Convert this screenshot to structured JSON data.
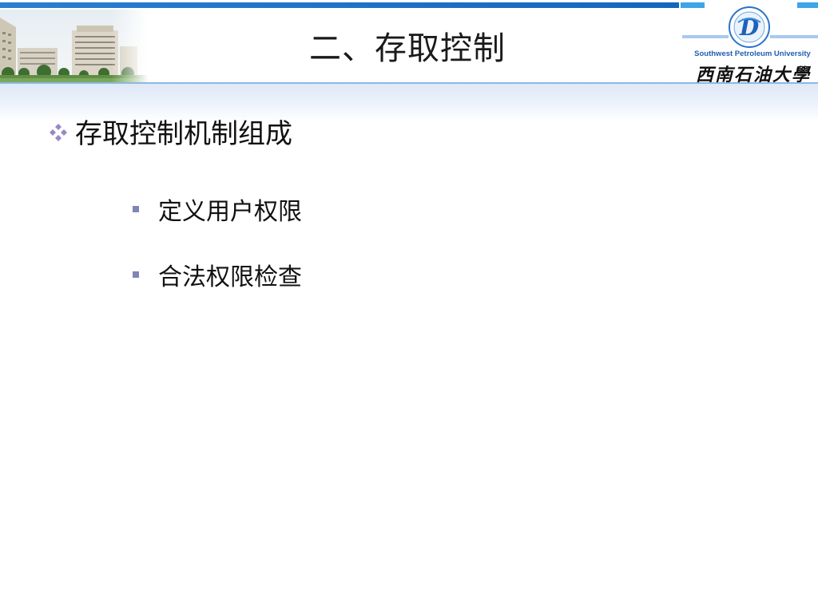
{
  "slide": {
    "title": "二、存取控制",
    "main_point": "存取控制机制组成",
    "sub_points": [
      "定义用户权限",
      "合法权限检查"
    ]
  },
  "logo": {
    "english_name": "Southwest Petroleum University",
    "chinese_name": "西南石油大學"
  },
  "colors": {
    "top_strip": "#1f6fc8",
    "accent_light": "#3da5e8",
    "bullet_diamond": "#9a88c4",
    "sub_bullet": "#7f86b6",
    "logo_blue": "#1f5fb0"
  },
  "icons": {
    "main_bullet": "four-diamond-bullet-icon",
    "sub_bullet": "square-bullet-icon"
  }
}
